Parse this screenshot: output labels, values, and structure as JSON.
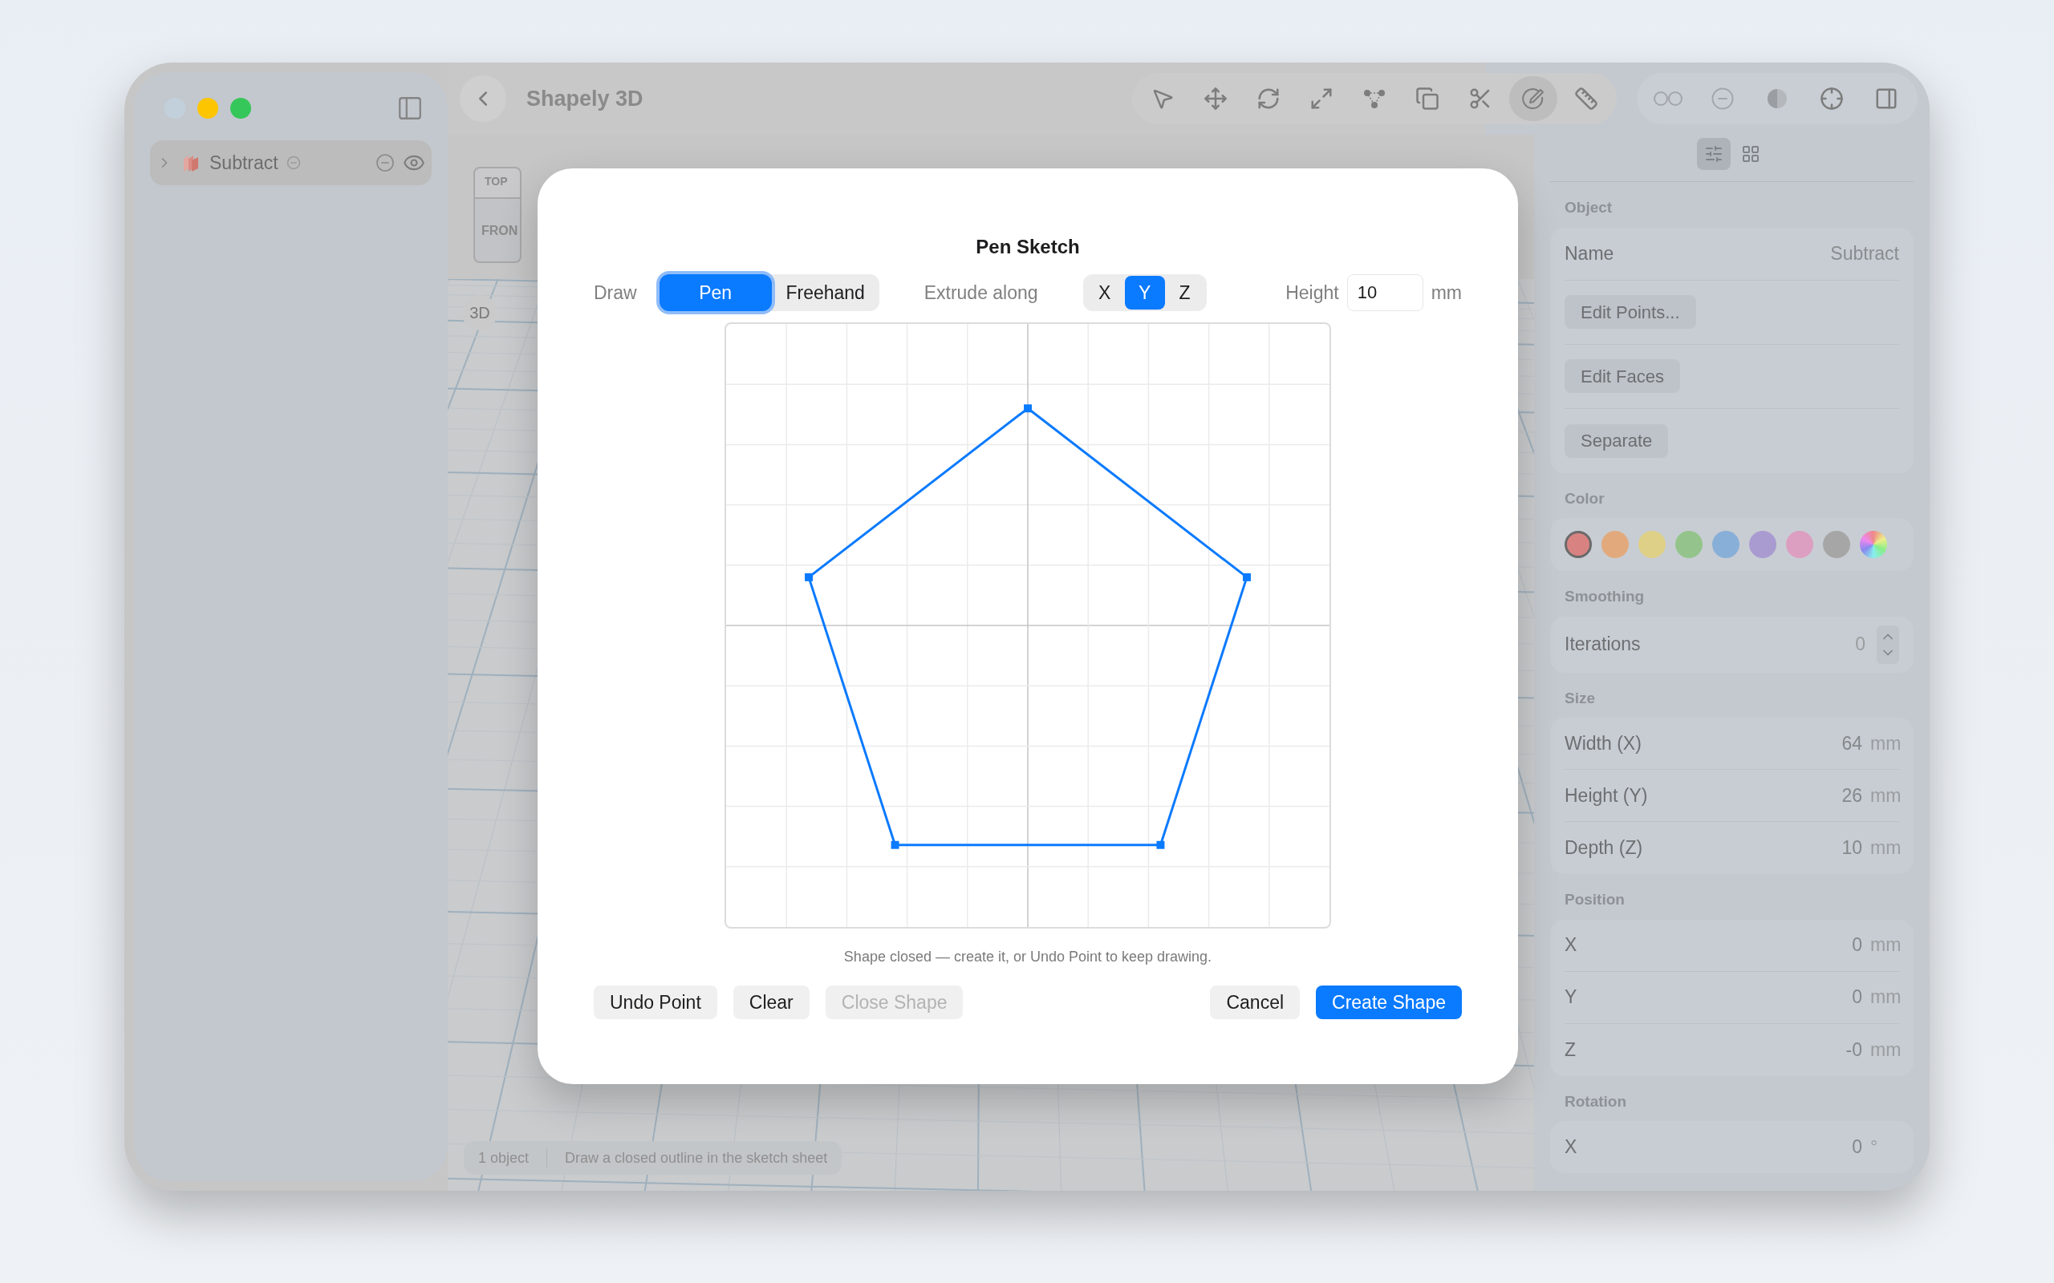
{
  "window": {
    "title": "Shapely 3D"
  },
  "sidebar": {
    "items": [
      {
        "label": "Subtract",
        "expanded": false
      }
    ]
  },
  "toolbar": {
    "tools": [
      {
        "kind": "pointer",
        "selected": false
      },
      {
        "kind": "move",
        "selected": false
      },
      {
        "kind": "rotate",
        "selected": false
      },
      {
        "kind": "scale",
        "selected": false
      },
      {
        "kind": "vertices",
        "selected": false
      },
      {
        "kind": "duplicate",
        "selected": false
      },
      {
        "kind": "cut",
        "selected": false
      },
      {
        "kind": "sketch",
        "selected": true
      },
      {
        "kind": "measure",
        "selected": false
      }
    ],
    "view_tools": [
      {
        "kind": "pair"
      },
      {
        "kind": "subtract"
      },
      {
        "kind": "contrast"
      },
      {
        "kind": "target"
      },
      {
        "kind": "panel"
      }
    ]
  },
  "viewport": {
    "view_cube": [
      "TOP",
      "FRON"
    ],
    "view_badge": "3D"
  },
  "status_bar": {
    "count": "1 object",
    "hint": "Draw a closed outline in the sketch sheet"
  },
  "inspector": {
    "tabs": [
      {
        "kind": "properties",
        "selected": true
      },
      {
        "kind": "grid",
        "selected": false
      }
    ],
    "object": {
      "header": "Object",
      "name_label": "Name",
      "name_value": "Subtract",
      "buttons": [
        "Edit Points...",
        "Edit Faces",
        "Separate"
      ]
    },
    "color": {
      "header": "Color",
      "swatches": [
        {
          "color": "#d98282",
          "selected": true
        },
        {
          "color": "#e2aa7c",
          "selected": false
        },
        {
          "color": "#ded086",
          "selected": false
        },
        {
          "color": "#94c48b",
          "selected": false
        },
        {
          "color": "#88afd8",
          "selected": false
        },
        {
          "color": "#a99bd0",
          "selected": false
        },
        {
          "color": "#dc9ec1",
          "selected": false
        },
        {
          "color": "#a6a6a6",
          "selected": false
        },
        {
          "kind": "spectrum",
          "selected": false
        }
      ]
    },
    "smoothing": {
      "header": "Smoothing",
      "label": "Iterations",
      "value": "0"
    },
    "sections": [
      {
        "header": "Size",
        "rows": [
          {
            "label": "Width (X)",
            "value": "64",
            "unit": "mm"
          },
          {
            "label": "Height (Y)",
            "value": "26",
            "unit": "mm"
          },
          {
            "label": "Depth (Z)",
            "value": "10",
            "unit": "mm"
          }
        ]
      },
      {
        "header": "Position",
        "rows": [
          {
            "label": "X",
            "value": "0",
            "unit": "mm"
          },
          {
            "label": "Y",
            "value": "0",
            "unit": "mm"
          },
          {
            "label": "Z",
            "value": "-0",
            "unit": "mm"
          }
        ]
      },
      {
        "header": "Rotation",
        "rows": [
          {
            "label": "X",
            "value": "0",
            "unit": "°"
          }
        ]
      }
    ]
  },
  "dialog": {
    "title": "Pen Sketch",
    "draw_label": "Draw",
    "modes": [
      {
        "label": "Pen",
        "selected": true
      },
      {
        "label": "Freehand",
        "selected": false
      }
    ],
    "extrude_label": "Extrude along",
    "axes": [
      {
        "label": "X",
        "selected": false
      },
      {
        "label": "Y",
        "selected": true
      },
      {
        "label": "Z",
        "selected": false
      }
    ],
    "height_label": "Height",
    "height_value": "10",
    "height_unit": "mm",
    "hint": "Shape closed — create it, or Undo Point to keep drawing.",
    "left_buttons": [
      {
        "label": "Undo Point",
        "disabled": false
      },
      {
        "label": "Clear",
        "disabled": false
      },
      {
        "label": "Close Shape",
        "disabled": true
      }
    ],
    "right_buttons": [
      {
        "label": "Cancel",
        "kind": "secondary"
      },
      {
        "label": "Create Shape",
        "kind": "primary"
      }
    ]
  }
}
